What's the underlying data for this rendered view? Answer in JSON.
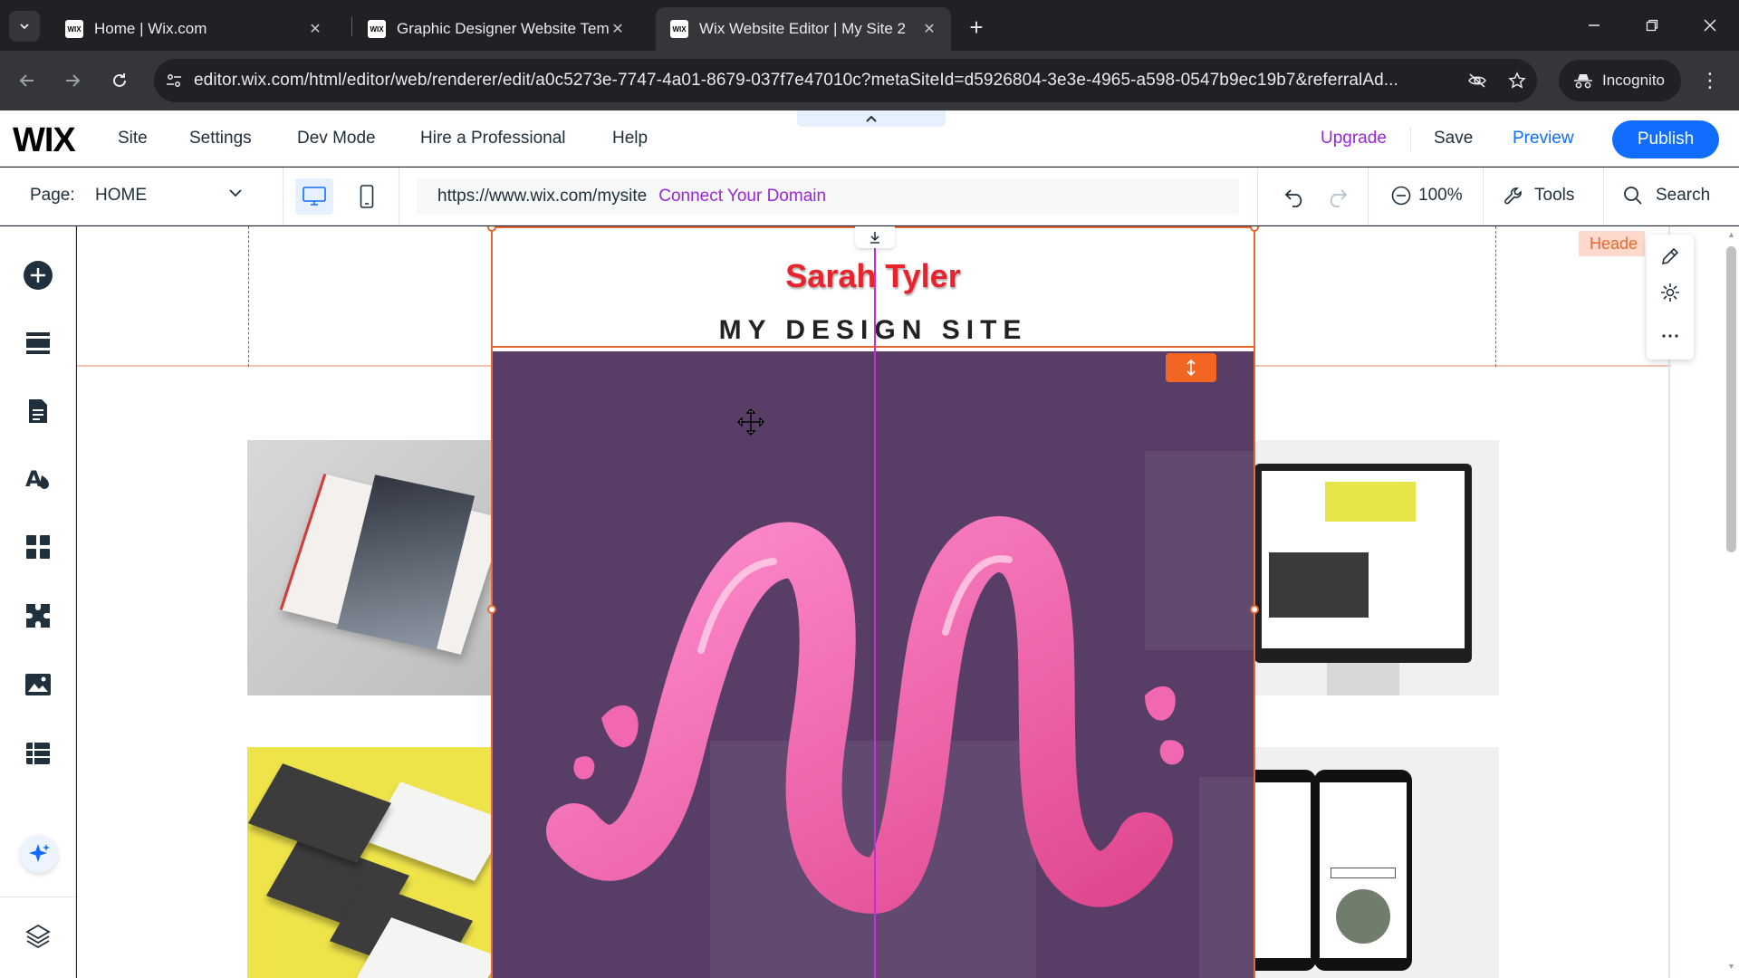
{
  "browser": {
    "tabs": [
      {
        "title": "Home | Wix.com",
        "active": false
      },
      {
        "title": "Graphic Designer Website Temp",
        "active": false
      },
      {
        "title": "Wix Website Editor | My Site 2",
        "active": true
      }
    ],
    "favicon_text": "WIX",
    "url": "editor.wix.com/html/editor/web/renderer/edit/a0c5273e-7747-4a01-8679-037f7e47010c?metaSiteId=d5926804-3e3e-4965-a598-0547b9ec19b7&referralAd...",
    "incognito_label": "Incognito"
  },
  "wix_topbar": {
    "logo": "WIX",
    "menu": [
      "Site",
      "Settings",
      "Dev Mode",
      "Hire a Professional",
      "Help"
    ],
    "upgrade": "Upgrade",
    "save": "Save",
    "preview": "Preview",
    "publish": "Publish"
  },
  "wix_secondbar": {
    "page_label": "Page:",
    "page_value": "HOME",
    "site_url": "https://www.wix.com/mysite",
    "connect_domain": "Connect Your Domain",
    "zoom": "100%",
    "tools": "Tools",
    "search": "Search"
  },
  "canvas": {
    "header_tag": "Heade",
    "site_name": "Sarah Tyler",
    "site_tagline": "MY DESIGN SITE",
    "strip_color": "#583e67",
    "selection_color": "#e9682f",
    "guide_color": "#c42fd6"
  },
  "icons": {
    "sidebar": [
      "add-elements-icon",
      "sections-icon",
      "pages-icon",
      "site-design-icon",
      "add-apps-icon",
      "business-icon",
      "media-icon",
      "cms-icon",
      "ai-assistant-icon",
      "layers-icon"
    ],
    "floating": [
      "edit-icon",
      "settings-icon",
      "more-icon"
    ]
  },
  "colors": {
    "brand_blue": "#116dff",
    "upgrade_purple": "#9a27d5"
  }
}
